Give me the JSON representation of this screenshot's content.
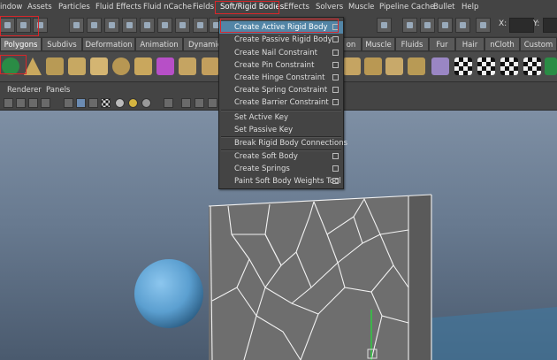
{
  "menubar": {
    "items": [
      "indow",
      "Assets",
      "Particles",
      "Fluid Effects",
      "Fluid nCache",
      "Fields",
      "Soft/Rigid Bodies",
      "Effects",
      "Solvers",
      "Muscle",
      "Pipeline Cache",
      "Bullet",
      "Help"
    ],
    "x_label": "X:",
    "y_label": "Y:"
  },
  "shelf_tabs": [
    "Polygons",
    "Subdivs",
    "Deformation",
    "Animation",
    "Dynamics",
    "on",
    "Muscle",
    "Fluids",
    "Fur",
    "Hair",
    "nCloth",
    "Custom"
  ],
  "active_shelf_tab": "Polygons",
  "panel_menu": [
    "Renderer",
    "Panels"
  ],
  "dropdown": {
    "items": [
      {
        "label": "Create Active Rigid Body",
        "option_box": true,
        "highlighted": true
      },
      {
        "label": "Create Passive Rigid Body",
        "option_box": true
      },
      {
        "label": "Create Nail Constraint",
        "option_box": true
      },
      {
        "label": "Create Pin Constraint",
        "option_box": true
      },
      {
        "label": "Create Hinge Constraint",
        "option_box": true
      },
      {
        "label": "Create Spring Constraint",
        "option_box": true
      },
      {
        "label": "Create Barrier Constraint",
        "option_box": true
      },
      {
        "label": "Set Active Key",
        "option_box": false
      },
      {
        "label": "Set Passive Key",
        "option_box": false
      },
      {
        "label": "Break Rigid Body Connections",
        "option_box": false
      },
      {
        "label": "Create Soft Body",
        "option_box": true
      },
      {
        "label": "Create Springs",
        "option_box": true
      },
      {
        "label": "Paint Soft Body Weights Tool",
        "option_box": true
      }
    ]
  },
  "colors": {
    "highlight": "#5285a6",
    "annotation_red": "#d8262a",
    "sphere": "#5b9fd0"
  }
}
